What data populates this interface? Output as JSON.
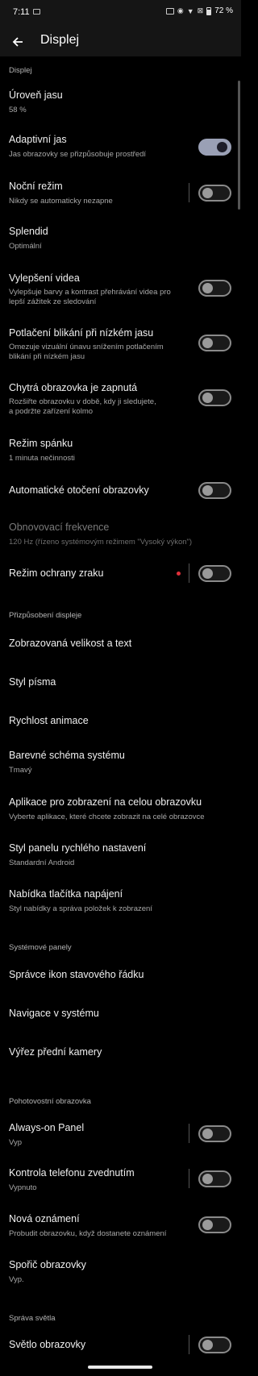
{
  "status_bar": {
    "time": "7:11",
    "battery": "72 %"
  },
  "app_bar": {
    "title": "Displej"
  },
  "sections": [
    {
      "header": "Displej",
      "items": [
        {
          "title": "Úroveň jasu",
          "subtitle": "58 %"
        },
        {
          "title": "Adaptivní jas",
          "subtitle": "Jas obrazovky se přizpůsobuje prostředí",
          "toggle": true
        },
        {
          "title": "Noční režim",
          "subtitle": "Nikdy se automaticky nezapne",
          "toggle": false
        },
        {
          "title": "Splendid",
          "subtitle": "Optimální"
        },
        {
          "title": "Vylepšení videa",
          "subtitle_lines": [
            "Vylepšuje barvy a kontrast přehrávání videa pro",
            "lepší zážitek ze sledování"
          ],
          "toggle": false
        },
        {
          "title": "Potlačení blikání při nízkém jasu",
          "subtitle_lines": [
            "Omezuje vizuální únavu snížením potlačením",
            "blikání při nízkém jasu"
          ],
          "toggle": false
        },
        {
          "title": "Chytrá obrazovka je zapnutá",
          "subtitle_lines": [
            "Rozšiřte obrazovku v době, kdy ji sledujete,",
            "a podržte zařízení kolmo"
          ],
          "toggle": false
        },
        {
          "title": "Režim spánku",
          "subtitle": "1 minuta nečinnosti"
        },
        {
          "title": "Automatické otočení obrazovky",
          "toggle": false
        },
        {
          "title": "Obnovovací frekvence",
          "subtitle": "120 Hz (řízeno systémovým režimem \"Vysoký výkon\")"
        },
        {
          "title": "Režim ochrany zraku",
          "toggle": false
        }
      ]
    },
    {
      "header": "Přizpůsobení displeje",
      "items": [
        {
          "title": "Zobrazovaná velikost a text"
        },
        {
          "title": "Styl písma"
        },
        {
          "title": "Rychlost animace"
        },
        {
          "title": "Barevné schéma systému",
          "subtitle": "Tmavý"
        },
        {
          "title": "Aplikace pro zobrazení na celou obrazovku",
          "subtitle": "Vyberte aplikace, které chcete zobrazit na celé obrazovce"
        },
        {
          "title": "Styl panelu rychlého nastavení",
          "subtitle": "Standardní Android"
        },
        {
          "title": "Nabídka tlačítka napájení",
          "subtitle": "Styl nabídky a správa položek k zobrazení"
        }
      ]
    },
    {
      "header": "Systémové panely",
      "items": [
        {
          "title": "Správce ikon stavového řádku"
        },
        {
          "title": "Navigace v systému"
        },
        {
          "title": "Výřez přední kamery"
        }
      ]
    },
    {
      "header": "Pohotovostní obrazovka",
      "items": [
        {
          "title": "Always-on Panel",
          "subtitle": "Vyp",
          "toggle": false
        },
        {
          "title": "Kontrola telefonu zvednutím",
          "subtitle": "Vypnuto",
          "toggle": false
        },
        {
          "title": "Nová oznámení",
          "subtitle": "Probudit obrazovku, když dostanete oznámení",
          "toggle": false
        },
        {
          "title": "Spořič obrazovky",
          "subtitle": "Vyp."
        }
      ]
    },
    {
      "header": "Správa světla",
      "items": [
        {
          "title": "Světlo obrazovky",
          "toggle": false
        }
      ]
    }
  ],
  "colors": {
    "background": "#000000",
    "toggle_on": "#9aa0b5",
    "red_dot": "#e0303a"
  }
}
